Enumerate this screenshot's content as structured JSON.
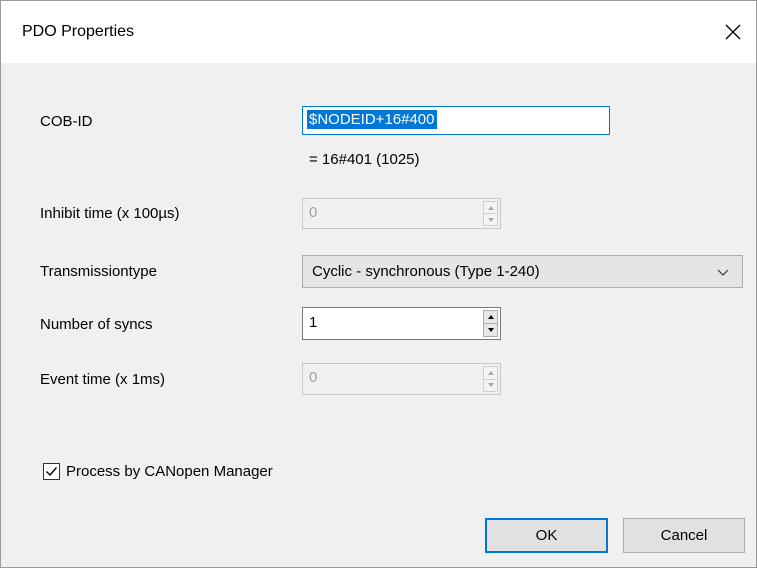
{
  "window": {
    "title": "PDO Properties"
  },
  "fields": {
    "cob_id": {
      "label": "COB-ID",
      "value": "$NODEID+16#400",
      "computed": "= 16#401 (1025)"
    },
    "inhibit_time": {
      "label": "Inhibit time (x 100µs)",
      "value": "0",
      "enabled": false
    },
    "transmission_type": {
      "label": "Transmissiontype",
      "value": "Cyclic - synchronous (Type 1-240)"
    },
    "number_of_syncs": {
      "label": "Number of syncs",
      "value": "1",
      "enabled": true
    },
    "event_time": {
      "label": "Event time (x 1ms)",
      "value": "0",
      "enabled": false
    }
  },
  "checkbox": {
    "label": "Process by CANopen Manager",
    "checked": true
  },
  "buttons": {
    "ok": "OK",
    "cancel": "Cancel"
  },
  "colors": {
    "accent": "#0078d7",
    "dialog_bg": "#f0f0f0",
    "disabled_text": "#a0a0a0"
  }
}
